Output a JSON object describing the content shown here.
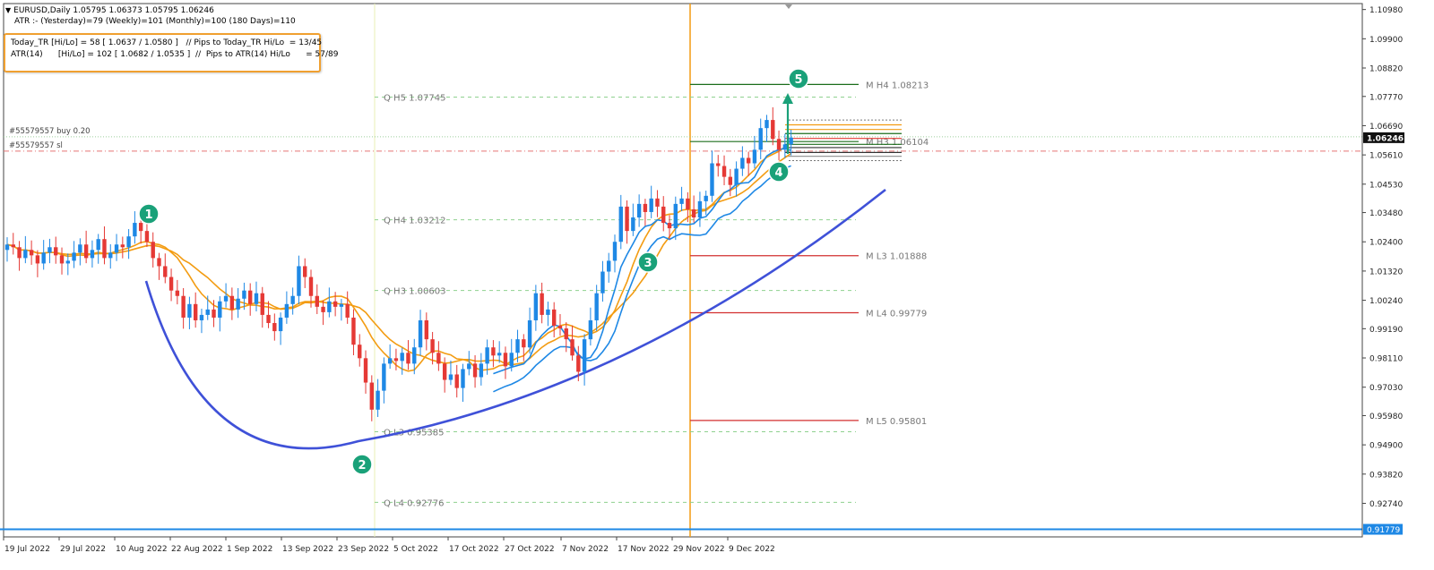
{
  "header": {
    "symbol_line": "EURUSD,Daily  1.05795 1.06373 1.05795 1.06246",
    "atr_line": "ATR :- (Yesterday)=79       (Weekly)=101       (Monthly)=100       (180 Days)=110"
  },
  "info_box": {
    "line1": "Today_TR [Hi/Lo] = 58 [ 1.0637 / 1.0580 ]   // Pips to Today_TR Hi/Lo  = 13/45",
    "line2": "ATR(14)      [Hi/Lo] = 102 [ 1.0682 / 1.0535 ]  //  Pips to ATR(14) Hi/Lo      = 57/89"
  },
  "order_labels": {
    "buy": "#55579557 buy 0.20",
    "sl": "#55579557 sl"
  },
  "colors": {
    "bull": "#1e88e5",
    "bear": "#e53935",
    "ma_orange": "#f39c12",
    "ma_blue": "#1e88e5",
    "curve": "#3f51d8",
    "marker": "#1aa179",
    "vline": "#f39c12",
    "level_green": "#1b6e1b",
    "level_red": "#d32f2f"
  },
  "markers": [
    "1",
    "2",
    "3",
    "4",
    "5"
  ],
  "chart_data": {
    "type": "candlestick",
    "symbol": "EURUSD",
    "timeframe": "Daily",
    "last_price": 1.06246,
    "ylim": [
      0.915,
      1.112
    ],
    "y_ticks": [
      "1.10980",
      "1.09900",
      "1.08820",
      "1.07770",
      "1.06690",
      "1.05610",
      "1.04530",
      "1.03480",
      "1.02400",
      "1.01320",
      "1.00240",
      "0.99190",
      "0.98110",
      "0.97030",
      "0.95980",
      "0.94900",
      "0.93820",
      "0.92740"
    ],
    "x_ticks": [
      "19 Jul 2022",
      "29 Jul 2022",
      "10 Aug 2022",
      "22 Aug 2022",
      "1 Sep 2022",
      "13 Sep 2022",
      "23 Sep 2022",
      "5 Oct 2022",
      "17 Oct 2022",
      "27 Oct 2022",
      "7 Nov 2022",
      "17 Nov 2022",
      "29 Nov 2022",
      "9 Dec 2022"
    ],
    "closes": [
      1.023,
      1.022,
      1.018,
      1.021,
      1.019,
      1.016,
      1.02,
      1.022,
      1.019,
      1.016,
      1.017,
      1.02,
      1.023,
      1.018,
      1.021,
      1.025,
      1.018,
      1.02,
      1.023,
      1.022,
      1.026,
      1.031,
      1.028,
      1.024,
      1.018,
      1.015,
      1.011,
      1.006,
      1.004,
      0.996,
      1.001,
      0.995,
      0.997,
      0.999,
      0.996,
      1.002,
      1.004,
      0.999,
      1.003,
      1.006,
      1.001,
      1.005,
      0.997,
      0.994,
      0.991,
      0.996,
      1.001,
      1.004,
      1.015,
      1.011,
      1.004,
      1.0,
      0.998,
      1.002,
      1.0,
      1.001,
      0.996,
      0.986,
      0.981,
      0.972,
      0.962,
      0.969,
      0.979,
      0.981,
      0.98,
      0.983,
      0.979,
      0.985,
      0.995,
      0.988,
      0.983,
      0.979,
      0.973,
      0.975,
      0.97,
      0.977,
      0.979,
      0.974,
      0.979,
      0.985,
      0.982,
      0.983,
      0.978,
      0.983,
      0.988,
      0.985,
      0.995,
      1.005,
      0.997,
      0.999,
      0.993,
      0.992,
      0.988,
      0.982,
      0.976,
      0.988,
      0.995,
      1.005,
      1.013,
      1.017,
      1.024,
      1.037,
      1.028,
      1.033,
      1.038,
      1.035,
      1.04,
      1.037,
      1.031,
      1.029,
      1.038,
      1.04,
      1.036,
      1.033,
      1.039,
      1.041,
      1.053,
      1.052,
      1.048,
      1.045,
      1.051,
      1.055,
      1.053,
      1.058,
      1.066,
      1.069,
      1.062,
      1.058,
      1.06,
      1.0625
    ],
    "indicators": [
      "moving average (orange)",
      "moving average (orange)",
      "moving average (blue)",
      "moving average (blue)"
    ],
    "pivot_levels": [
      {
        "label": "Q  H5 1.07745",
        "value": 1.07745
      },
      {
        "label": "Q  H4 1.03212",
        "value": 1.03212
      },
      {
        "label": "Q  H3 1.00603",
        "value": 1.00603
      },
      {
        "label": "Q  L3 0.95385",
        "value": 0.95385
      },
      {
        "label": "Q  L4 0.92776",
        "value": 0.92776
      },
      {
        "label": "M  H4 1.08213",
        "value": 1.08213
      },
      {
        "label": "M  H3 1.06104",
        "value": 1.06104
      },
      {
        "label": "M  L3 1.01888",
        "value": 1.01888
      },
      {
        "label": "M  L4 0.99779",
        "value": 0.99779
      },
      {
        "label": "M  L5 0.95801",
        "value": 0.95801
      }
    ],
    "order_levels": {
      "buy": 1.0628,
      "sl": 1.0575,
      "bottom_line": 0.9178
    },
    "bottom_line_label": "0.91779"
  }
}
